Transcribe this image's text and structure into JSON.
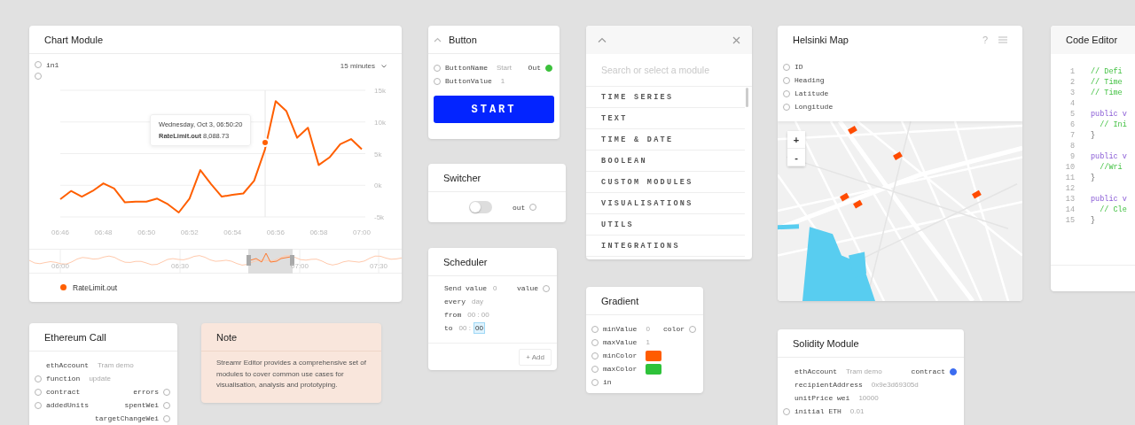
{
  "canvas": {
    "modules": [
      {
        "kind": "chart",
        "title": "Chart Module",
        "inputs": [
          {
            "kind": "named",
            "name": "in1"
          },
          {
            "kind": "unnamed"
          }
        ],
        "range": "15 minutes",
        "chart_data": {
          "type": "line",
          "categories": [
            "06:46",
            null,
            null,
            null,
            "06:48",
            null,
            null,
            null,
            "06:50",
            null,
            null,
            null,
            "06:52",
            null,
            null,
            null,
            "06:54",
            null,
            null,
            null,
            "06:56",
            null,
            null,
            null,
            "06:58",
            null,
            null,
            null,
            "07:00"
          ],
          "series": [
            {
              "name": "RateLimit.out",
              "color": "#ff5f00",
              "values": [
                -2200,
                -900,
                -1800,
                -900,
                300,
                -500,
                -2700,
                -2600,
                -2600,
                -2100,
                -3000,
                -4300,
                -2100,
                2400,
                200,
                -1800,
                -1500,
                -1300,
                700,
                5600,
                13300,
                11700,
                7500,
                9100,
                3200,
                4400,
                6500,
                7300,
                5700
              ]
            }
          ],
          "ylim": [
            -5000,
            15000
          ],
          "grid": true,
          "yticks": [
            {
              "value": -5000,
              "label": "-5k"
            },
            {
              "value": 0,
              "label": "0k"
            },
            {
              "value": 5000,
              "label": "5k"
            },
            {
              "value": 10000,
              "label": "10k"
            },
            {
              "value": 15000,
              "label": "15k"
            }
          ],
          "orientation": "vertical"
        },
        "tooltip": {
          "title": "Wednesday, Oct 3, 06:50:20",
          "body": "**RateLimit.out** 8,088.73"
        },
        "navigator": {
          "labels": [
            "06:00",
            "06:30",
            "07:00",
            "07:30"
          ]
        }
      },
      {
        "kind": "button",
        "title": "Button",
        "rows": [
          {
            "input": {
              "name": "ButtonName",
              "value": "Start",
              "port": true
            },
            "output": {
              "name": "Out",
              "color": "#3cc13c"
            }
          },
          {
            "input": {
              "name": "ButtonValue",
              "value": "1",
              "port": true
            }
          }
        ],
        "action": "START"
      },
      {
        "kind": "switcher",
        "title": "Switcher",
        "on": false,
        "output": {
          "name": "out"
        }
      },
      {
        "kind": "scheduler",
        "title": "Scheduler",
        "rows": [
          {
            "label": "Send value",
            "fields": [
              {
                "text": "0",
                "selected": false
              }
            ],
            "output": {
              "name": "value"
            }
          },
          {
            "label": "every",
            "fields": [
              {
                "text": "day",
                "selected": false
              }
            ]
          },
          {
            "label": "from",
            "fields": [
              {
                "text": "00 : 00",
                "selected": false
              }
            ]
          },
          {
            "label": "to",
            "fields": [
              {
                "text": "00 :",
                "selected": false
              },
              {
                "text": "00",
                "selected": true
              }
            ]
          }
        ],
        "add": "+ Add"
      },
      {
        "kind": "module_list",
        "search": {
          "placeholder": "Search or select a module"
        },
        "categories": [
          "TIME SERIES",
          "TEXT",
          "TIME & DATE",
          "BOOLEAN",
          "CUSTOM MODULES",
          "VISUALISATIONS",
          "UTILS",
          "INTEGRATIONS"
        ]
      },
      {
        "kind": "ports",
        "title": "Gradient",
        "rows": [
          {
            "input": {
              "name": "minValue",
              "value": "0",
              "port": true
            },
            "output": {
              "name": "color"
            }
          },
          {
            "input": {
              "name": "maxValue",
              "value": "1",
              "port": true
            }
          },
          {
            "input": {
              "name": "minColor",
              "color": "#ff5c00",
              "port": true
            }
          },
          {
            "input": {
              "name": "maxColor",
              "color": "#2ec23a",
              "port": true
            }
          },
          {
            "input": {
              "name": "in",
              "port": true
            }
          }
        ]
      },
      {
        "kind": "map",
        "title": "Helsinki Map",
        "help": "?",
        "inputs": [
          "ID",
          "Heading",
          "Latitude",
          "Longitude"
        ],
        "map": {
          "kind": "picture"
        },
        "zoom": [
          "+",
          "-"
        ]
      },
      {
        "kind": "code",
        "title": "Code Editor",
        "lines": [
          {
            "number": "1",
            "kind": "comment",
            "code": "// Defi"
          },
          {
            "number": "2",
            "kind": "comment",
            "code": "// Time"
          },
          {
            "number": "3",
            "kind": "comment",
            "code": "// Time"
          },
          {
            "number": "4"
          },
          {
            "number": "5",
            "kind": "keyword",
            "code": "public v"
          },
          {
            "number": "6",
            "kind": "comment",
            "code": "  // Ini"
          },
          {
            "number": "7",
            "kind": "plain",
            "code": "}"
          },
          {
            "number": "8"
          },
          {
            "number": "9",
            "kind": "keyword",
            "code": "public v"
          },
          {
            "number": "10",
            "kind": "comment",
            "code": "  //Wri"
          },
          {
            "number": "11",
            "kind": "plain",
            "code": "}"
          },
          {
            "number": "12"
          },
          {
            "number": "13",
            "kind": "keyword",
            "code": "public v"
          },
          {
            "number": "14",
            "kind": "comment",
            "code": "  // Cle"
          },
          {
            "number": "15",
            "kind": "plain",
            "code": "}"
          }
        ]
      },
      {
        "kind": "ports",
        "title": "Ethereum Call",
        "rows": [
          {
            "input": {
              "name": "ethAccount",
              "value": "Tram demo",
              "port": false
            }
          },
          {
            "input": {
              "name": "function",
              "value": "update",
              "port": true
            }
          },
          {
            "input": {
              "name": "contract",
              "port": true
            },
            "output": {
              "name": "errors"
            }
          },
          {
            "input": {
              "name": "addedUnits",
              "port": true
            },
            "output": {
              "name": "spentWei"
            }
          },
          {
            "output": {
              "name": "targetChangeWei"
            }
          }
        ]
      },
      {
        "kind": "note",
        "title": "Note",
        "text": "Streamr Editor provides a comprehensive set of modules to cover common use cases for visualisation, analysis and prototyping."
      },
      {
        "kind": "ports",
        "title": "Solidity Module",
        "rows": [
          {
            "input": {
              "name": "ethAccount",
              "value": "Tram demo",
              "port": false
            },
            "output": {
              "name": "contract",
              "color": "#3b6cf0"
            }
          },
          {
            "input": {
              "name": "recipientAddress",
              "value": "0x9e3d69305d",
              "port": false
            }
          },
          {
            "input": {
              "name": "unitPrice wei",
              "value": "10000",
              "port": false
            }
          },
          {
            "input": {
              "name": "initial ETH",
              "value": "0.01",
              "port": true
            }
          }
        ]
      }
    ]
  }
}
